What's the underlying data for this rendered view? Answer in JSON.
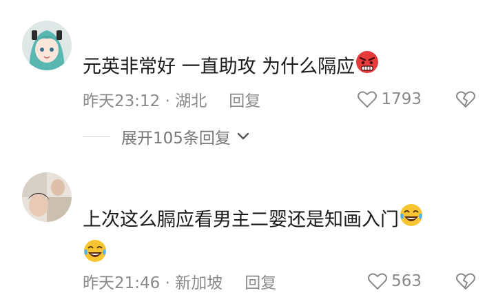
{
  "comments": [
    {
      "text": "元英非常好 一直助攻 为什么隔应",
      "emoji": "angry-face",
      "time": "昨天23:12 · 湖北",
      "reply_label": "回复",
      "likes": "1793",
      "expand_label": "展开105条回复"
    },
    {
      "text": "上次这么膈应看男主二婴还是知画入门",
      "emoji": "laughing-tears-face",
      "time": "昨天21:46 · 新加坡",
      "reply_label": "回复",
      "likes": "563"
    }
  ],
  "colors": {
    "text": "#1a1a1a",
    "meta": "#8a8a8a",
    "divider": "#cfcfcf"
  }
}
